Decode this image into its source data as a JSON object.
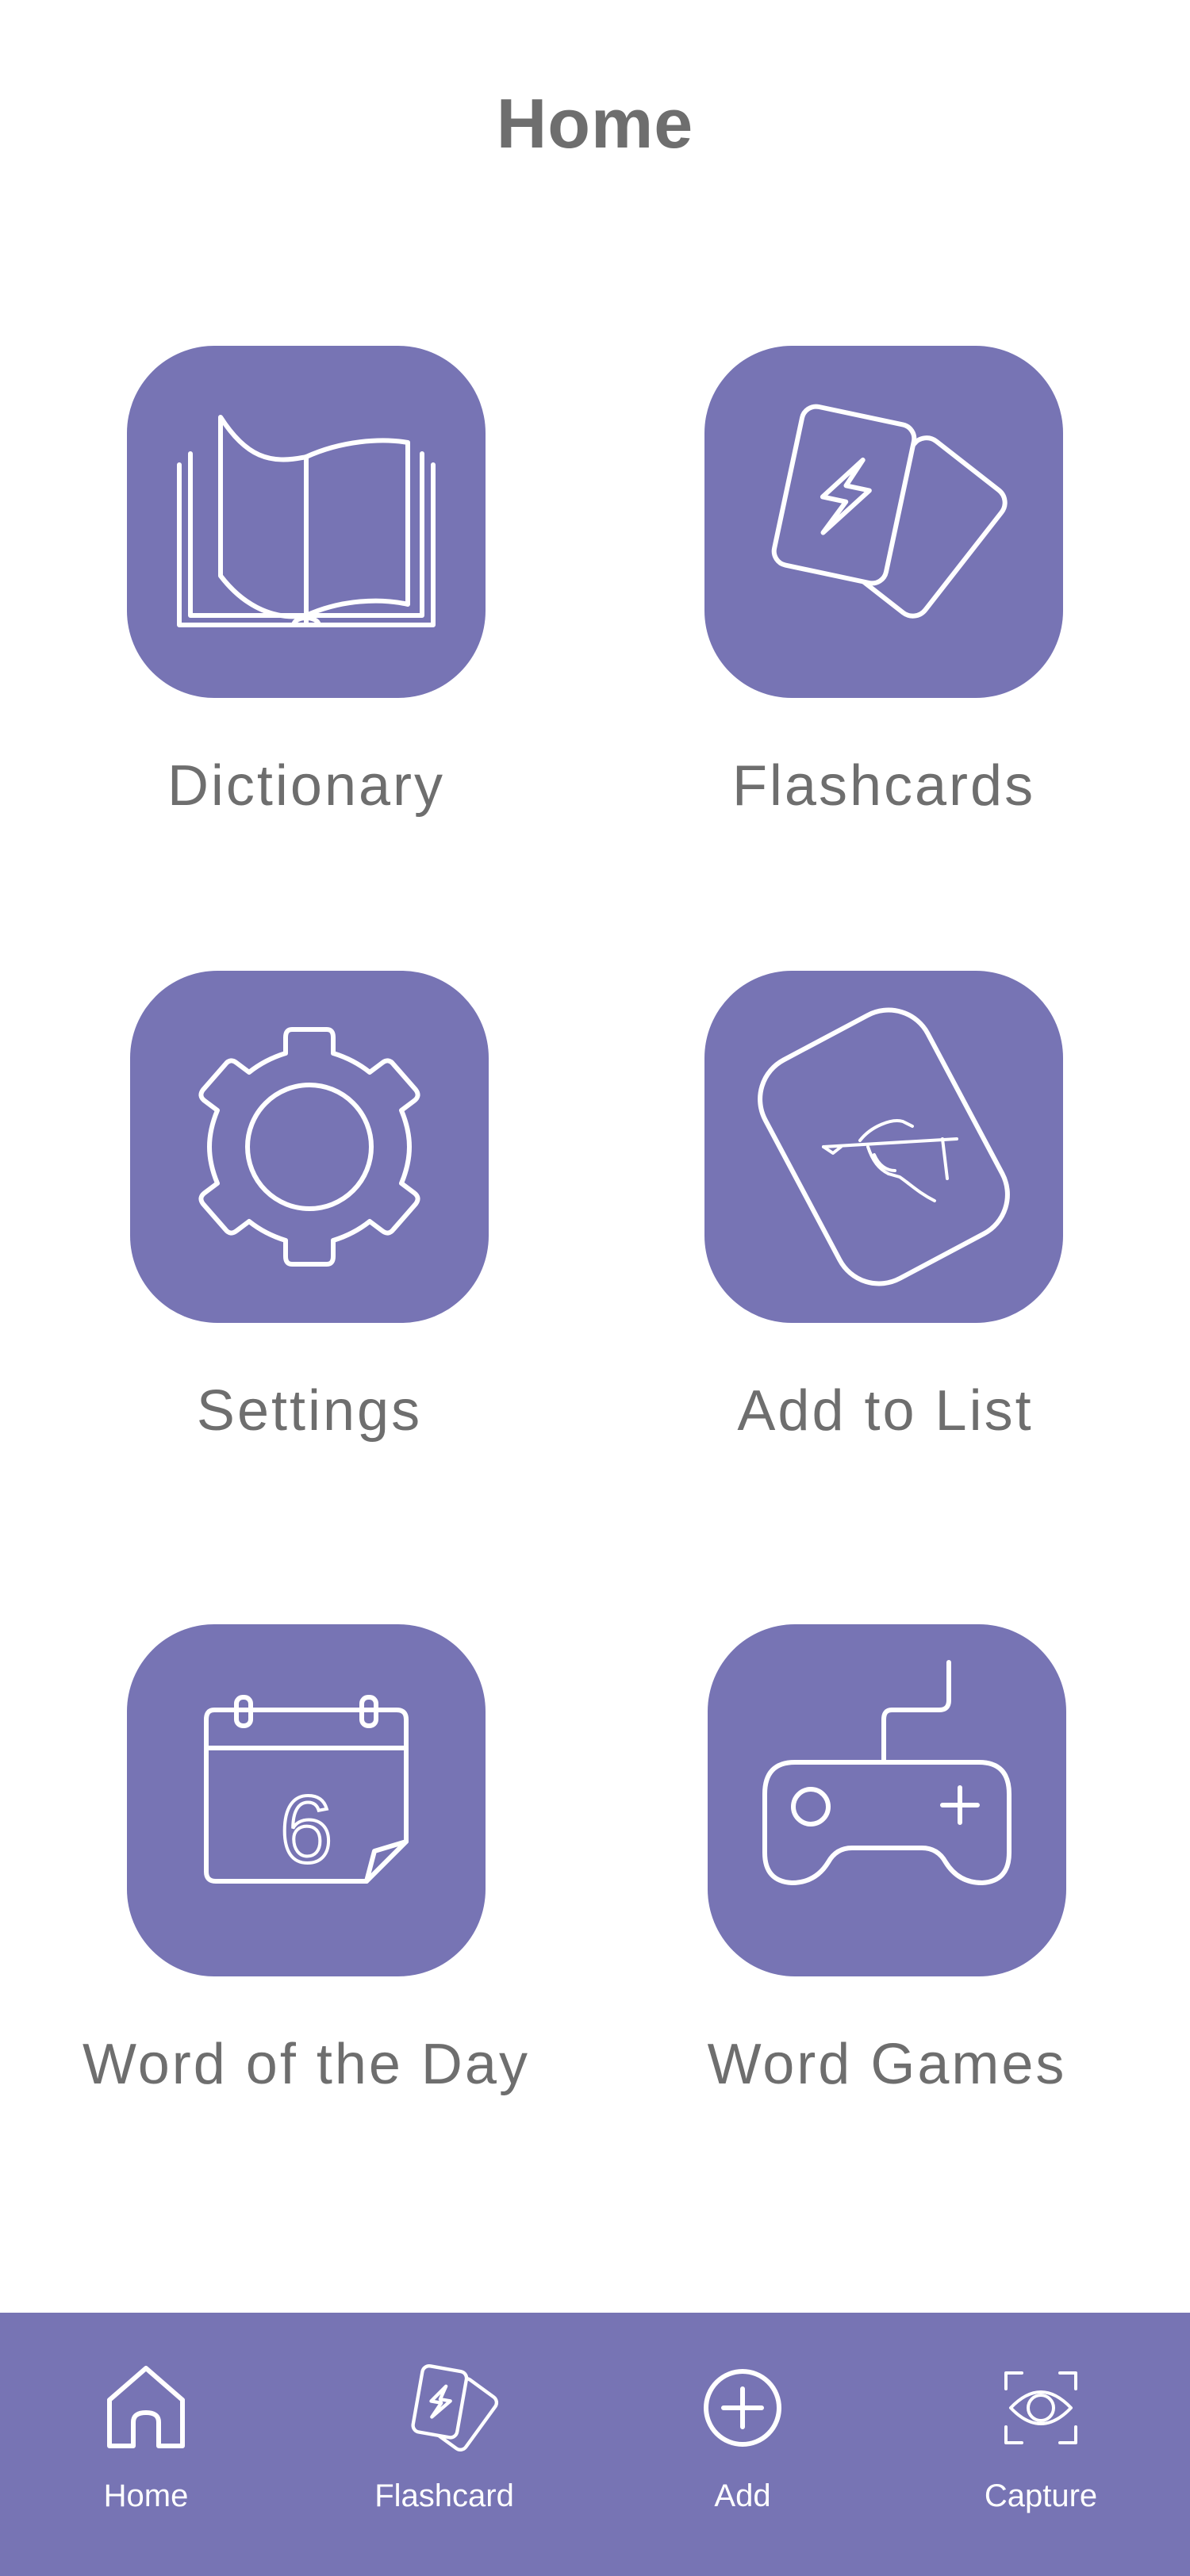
{
  "page": {
    "title": "Home"
  },
  "tiles": [
    {
      "label": "Dictionary",
      "icon": "open-book-icon"
    },
    {
      "label": "Flashcards",
      "icon": "flashcards-icon"
    },
    {
      "label": "Settings",
      "icon": "gear-icon"
    },
    {
      "label": "Add to List",
      "icon": "card-writing-icon"
    },
    {
      "label": "Word of the Day",
      "icon": "calendar-icon",
      "calendar_day": "6"
    },
    {
      "label": "Word Games",
      "icon": "gamepad-icon"
    }
  ],
  "nav": {
    "items": [
      {
        "label": "Home",
        "icon": "house-icon"
      },
      {
        "label": "Flashcard",
        "icon": "flashcards-icon"
      },
      {
        "label": "Add",
        "icon": "plus-circle-icon"
      },
      {
        "label": "Capture",
        "icon": "eye-scan-icon"
      }
    ]
  },
  "colors": {
    "accent": "#7774b4",
    "text": "#6e6e6e",
    "background": "#ffffff"
  }
}
